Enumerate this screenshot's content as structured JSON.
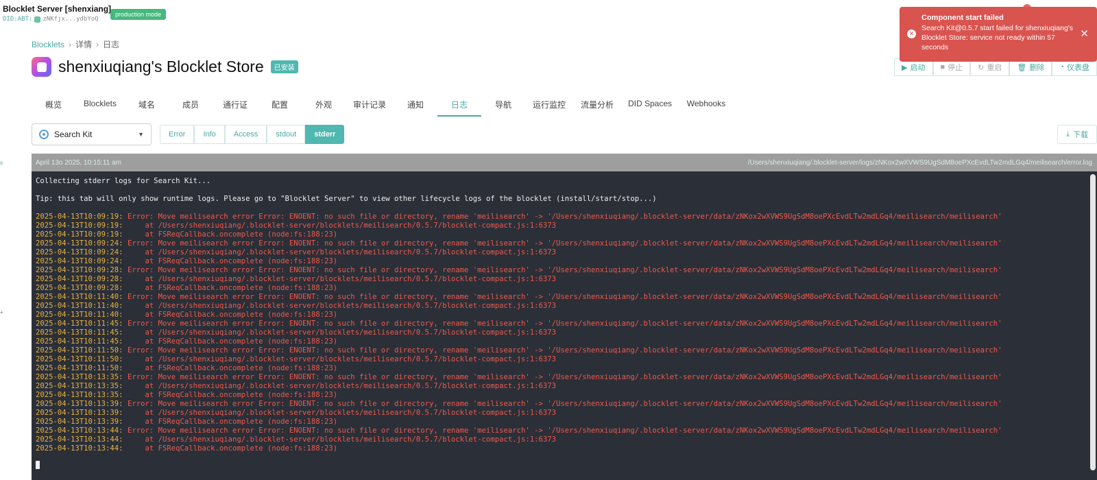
{
  "app": {
    "title": "Blocklet Server [shenxiang]",
    "did_label": "DID:ABT:",
    "did_value": "zNKfjx...ydbYoQ",
    "mode_badge": "production mode"
  },
  "breadcrumb": [
    "Blocklets",
    "详情",
    "日志"
  ],
  "header": {
    "title": "shenxiuqiang's Blocklet Store",
    "status_badge": "已安装"
  },
  "actions": [
    {
      "label": "启动",
      "icon": "play-icon",
      "glyph": "▶",
      "disabled": false
    },
    {
      "label": "停止",
      "icon": "stop-icon",
      "glyph": "■",
      "disabled": true
    },
    {
      "label": "重启",
      "icon": "restart-icon",
      "glyph": "↻",
      "disabled": true
    },
    {
      "label": "删除",
      "icon": "trash-icon",
      "glyph": "🗑",
      "disabled": false
    },
    {
      "label": "仪表盘",
      "icon": "dashboard-icon",
      "glyph": "◔",
      "disabled": false
    }
  ],
  "tabs": [
    "概览",
    "Blocklets",
    "域名",
    "成员",
    "通行证",
    "配置",
    "外观",
    "审计记录",
    "通知",
    "日志",
    "导航",
    "运行监控",
    "流量分析",
    "DID Spaces",
    "Webhooks"
  ],
  "active_tab": "日志",
  "component_select": {
    "value": "Search Kit"
  },
  "log_filters": [
    "Error",
    "Info",
    "Access",
    "stdout",
    "stderr"
  ],
  "active_filter": "stderr",
  "download_label": "下载",
  "log_meta": {
    "date": "April 13o 2025, 10:15:11 am",
    "path": "/Users/shenxiuqiang/.blocklet-server/logs/zNKox2wXVWS9UgSdM8oePXcEvdLTw2mdLGq4/meilisearch/error.log"
  },
  "log_intro": [
    "Collecting stderr logs for Search Kit...",
    "",
    "Tip: this tab will only show runtime logs. Please go to \"Blocklet Server\" to view other lifecycle logs of the blocklet (install/start/stop...)",
    ""
  ],
  "log_entries": [
    {
      "ts": "2025-04-13T10:09:19:",
      "msg": " Error: Move meilisearch error Error: ENOENT: no such file or directory, rename 'meilisearch' -> '/Users/shenxiuqiang/.blocklet-server/data/zNKox2wXVWS9UgSdM8oePXcEvdLTw2mdLGq4/meilisearch/meilisearch'"
    },
    {
      "ts": "2025-04-13T10:09:19:",
      "msg": "     at /Users/shenxiuqiang/.blocklet-server/blocklets/meilisearch/0.5.7/blocklet-compact.js:1:6373"
    },
    {
      "ts": "2025-04-13T10:09:19:",
      "msg": "     at FSReqCallback.oncomplete (node:fs:188:23)"
    },
    {
      "ts": "2025-04-13T10:09:24:",
      "msg": " Error: Move meilisearch error Error: ENOENT: no such file or directory, rename 'meilisearch' -> '/Users/shenxiuqiang/.blocklet-server/data/zNKox2wXVWS9UgSdM8oePXcEvdLTw2mdLGq4/meilisearch/meilisearch'"
    },
    {
      "ts": "2025-04-13T10:09:24:",
      "msg": "     at /Users/shenxiuqiang/.blocklet-server/blocklets/meilisearch/0.5.7/blocklet-compact.js:1:6373"
    },
    {
      "ts": "2025-04-13T10:09:24:",
      "msg": "     at FSReqCallback.oncomplete (node:fs:188:23)"
    },
    {
      "ts": "2025-04-13T10:09:28:",
      "msg": " Error: Move meilisearch error Error: ENOENT: no such file or directory, rename 'meilisearch' -> '/Users/shenxiuqiang/.blocklet-server/data/zNKox2wXVWS9UgSdM8oePXcEvdLTw2mdLGq4/meilisearch/meilisearch'"
    },
    {
      "ts": "2025-04-13T10:09:28:",
      "msg": "     at /Users/shenxiuqiang/.blocklet-server/blocklets/meilisearch/0.5.7/blocklet-compact.js:1:6373"
    },
    {
      "ts": "2025-04-13T10:09:28:",
      "msg": "     at FSReqCallback.oncomplete (node:fs:188:23)"
    },
    {
      "ts": "2025-04-13T10:11:40:",
      "msg": " Error: Move meilisearch error Error: ENOENT: no such file or directory, rename 'meilisearch' -> '/Users/shenxiuqiang/.blocklet-server/data/zNKox2wXVWS9UgSdM8oePXcEvdLTw2mdLGq4/meilisearch/meilisearch'"
    },
    {
      "ts": "2025-04-13T10:11:40:",
      "msg": "     at /Users/shenxiuqiang/.blocklet-server/blocklets/meilisearch/0.5.7/blocklet-compact.js:1:6373"
    },
    {
      "ts": "2025-04-13T10:11:40:",
      "msg": "     at FSReqCallback.oncomplete (node:fs:188:23)"
    },
    {
      "ts": "2025-04-13T10:11:45:",
      "msg": " Error: Move meilisearch error Error: ENOENT: no such file or directory, rename 'meilisearch' -> '/Users/shenxiuqiang/.blocklet-server/data/zNKox2wXVWS9UgSdM8oePXcEvdLTw2mdLGq4/meilisearch/meilisearch'"
    },
    {
      "ts": "2025-04-13T10:11:45:",
      "msg": "     at /Users/shenxiuqiang/.blocklet-server/blocklets/meilisearch/0.5.7/blocklet-compact.js:1:6373"
    },
    {
      "ts": "2025-04-13T10:11:45:",
      "msg": "     at FSReqCallback.oncomplete (node:fs:188:23)"
    },
    {
      "ts": "2025-04-13T10:11:50:",
      "msg": " Error: Move meilisearch error Error: ENOENT: no such file or directory, rename 'meilisearch' -> '/Users/shenxiuqiang/.blocklet-server/data/zNKox2wXVWS9UgSdM8oePXcEvdLTw2mdLGq4/meilisearch/meilisearch'"
    },
    {
      "ts": "2025-04-13T10:11:50:",
      "msg": "     at /Users/shenxiuqiang/.blocklet-server/blocklets/meilisearch/0.5.7/blocklet-compact.js:1:6373"
    },
    {
      "ts": "2025-04-13T10:11:50:",
      "msg": "     at FSReqCallback.oncomplete (node:fs:188:23)"
    },
    {
      "ts": "2025-04-13T10:13:35:",
      "msg": " Error: Move meilisearch error Error: ENOENT: no such file or directory, rename 'meilisearch' -> '/Users/shenxiuqiang/.blocklet-server/data/zNKox2wXVWS9UgSdM8oePXcEvdLTw2mdLGq4/meilisearch/meilisearch'"
    },
    {
      "ts": "2025-04-13T10:13:35:",
      "msg": "     at /Users/shenxiuqiang/.blocklet-server/blocklets/meilisearch/0.5.7/blocklet-compact.js:1:6373"
    },
    {
      "ts": "2025-04-13T10:13:35:",
      "msg": "     at FSReqCallback.oncomplete (node:fs:188:23)"
    },
    {
      "ts": "2025-04-13T10:13:39:",
      "msg": " Error: Move meilisearch error Error: ENOENT: no such file or directory, rename 'meilisearch' -> '/Users/shenxiuqiang/.blocklet-server/data/zNKox2wXVWS9UgSdM8oePXcEvdLTw2mdLGq4/meilisearch/meilisearch'"
    },
    {
      "ts": "2025-04-13T10:13:39:",
      "msg": "     at /Users/shenxiuqiang/.blocklet-server/blocklets/meilisearch/0.5.7/blocklet-compact.js:1:6373"
    },
    {
      "ts": "2025-04-13T10:13:39:",
      "msg": "     at FSReqCallback.oncomplete (node:fs:188:23)"
    },
    {
      "ts": "2025-04-13T10:13:44:",
      "msg": " Error: Move meilisearch error Error: ENOENT: no such file or directory, rename 'meilisearch' -> '/Users/shenxiuqiang/.blocklet-server/data/zNKox2wXVWS9UgSdM8oePXcEvdLTw2mdLGq4/meilisearch/meilisearch'"
    },
    {
      "ts": "2025-04-13T10:13:44:",
      "msg": "     at /Users/shenxiuqiang/.blocklet-server/blocklets/meilisearch/0.5.7/blocklet-compact.js:1:6373"
    },
    {
      "ts": "2025-04-13T10:13:44:",
      "msg": "     at FSReqCallback.oncomplete (node:fs:188:23)"
    }
  ],
  "toast": {
    "title": "Component start failed",
    "body": "Search Kit@0.5.7 start failed for shenxiuqiang's Blocklet Store: service not ready within 57 seconds"
  },
  "colors": {
    "accent": "#4aa8a0",
    "log_bg": "#2b2f38",
    "log_timestamp": "#e8b341",
    "log_error": "#ee5a4d",
    "toast_bg": "#d9534f"
  }
}
